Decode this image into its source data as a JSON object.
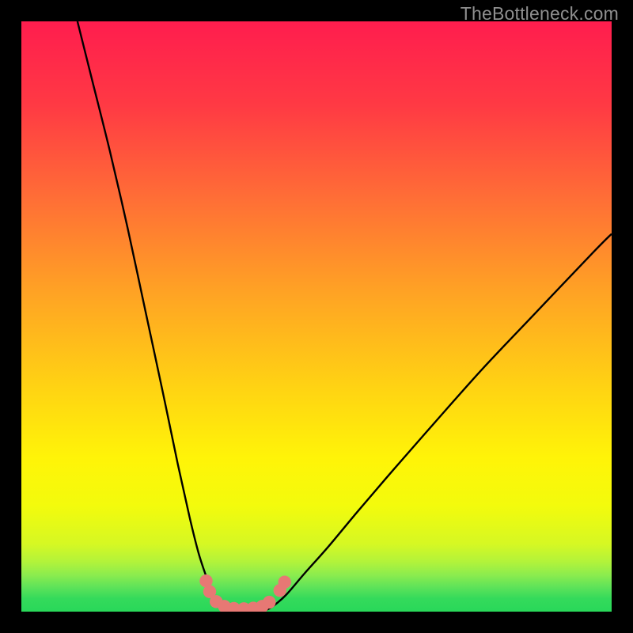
{
  "watermark": "TheBottleneck.com",
  "colors": {
    "black": "#000000",
    "curve": "#000000",
    "marker": "#e77874",
    "green_base": "#29d85a"
  },
  "chart_data": {
    "type": "line",
    "title": "",
    "xlabel": "",
    "ylabel": "",
    "xlim": [
      0,
      100
    ],
    "ylim": [
      0,
      100
    ],
    "annotations": [],
    "gradient_stops": [
      {
        "pos": 0.0,
        "color": "#ff1d4e"
      },
      {
        "pos": 0.14,
        "color": "#ff3944"
      },
      {
        "pos": 0.3,
        "color": "#ff6e36"
      },
      {
        "pos": 0.46,
        "color": "#ffa324"
      },
      {
        "pos": 0.62,
        "color": "#ffd313"
      },
      {
        "pos": 0.74,
        "color": "#fff408"
      },
      {
        "pos": 0.82,
        "color": "#f3fb0c"
      },
      {
        "pos": 0.885,
        "color": "#d6f823"
      },
      {
        "pos": 0.915,
        "color": "#b3f33a"
      },
      {
        "pos": 0.938,
        "color": "#8bec4e"
      },
      {
        "pos": 0.958,
        "color": "#5fe359"
      },
      {
        "pos": 0.978,
        "color": "#34da5b"
      },
      {
        "pos": 1.0,
        "color": "#29d85a"
      }
    ],
    "series": [
      {
        "name": "left-branch",
        "x": [
          9.5,
          12,
          15,
          18,
          21,
          24,
          26.5,
          28.5,
          30,
          31.3,
          32.3,
          33,
          33.6,
          34.2
        ],
        "y": [
          100,
          90,
          78,
          65,
          51,
          37,
          25,
          16,
          10,
          6,
          3.3,
          1.8,
          0.9,
          0.3
        ]
      },
      {
        "name": "floor",
        "x": [
          34.2,
          35.5,
          37,
          38.5,
          40,
          41.5
        ],
        "y": [
          0.3,
          0.1,
          0.05,
          0.05,
          0.1,
          0.3
        ]
      },
      {
        "name": "right-branch",
        "x": [
          41.5,
          43,
          45,
          48,
          52,
          57,
          63,
          70,
          78,
          87,
          97,
          100
        ],
        "y": [
          0.3,
          1.2,
          3.0,
          6.5,
          11,
          17,
          24,
          32,
          41,
          50.5,
          61,
          64
        ]
      }
    ],
    "markers": {
      "name": "highlight-dots",
      "points": [
        {
          "x": 31.3,
          "y": 5.2
        },
        {
          "x": 31.9,
          "y": 3.4
        },
        {
          "x": 33.0,
          "y": 1.7
        },
        {
          "x": 34.4,
          "y": 0.9
        },
        {
          "x": 36.0,
          "y": 0.55
        },
        {
          "x": 37.7,
          "y": 0.5
        },
        {
          "x": 39.3,
          "y": 0.6
        },
        {
          "x": 40.8,
          "y": 0.9
        },
        {
          "x": 42.0,
          "y": 1.6
        },
        {
          "x": 43.8,
          "y": 3.6
        },
        {
          "x": 44.6,
          "y": 5.0
        }
      ]
    }
  }
}
